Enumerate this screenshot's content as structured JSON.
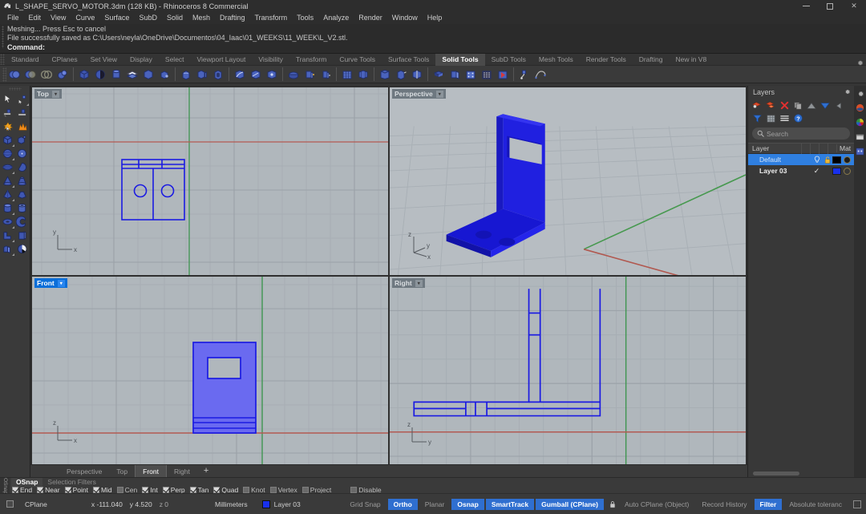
{
  "window": {
    "title": "L_SHAPE_SERVO_MOTOR.3dm (128 KB) - Rhinoceros 8 Commercial",
    "minimize_label": "Minimize",
    "maximize_label": "Maximize",
    "close_label": "Close"
  },
  "menu": {
    "items": [
      "File",
      "Edit",
      "View",
      "Curve",
      "Surface",
      "SubD",
      "Solid",
      "Mesh",
      "Drafting",
      "Transform",
      "Tools",
      "Analyze",
      "Render",
      "Window",
      "Help"
    ]
  },
  "command_area": {
    "history_line_1": "Meshing... Press Esc to cancel",
    "history_line_2": "File successfully saved as C:\\Users\\neyla\\OneDrive\\Documentos\\04_Iaac\\01_WEEKS\\11_WEEK\\L_V2.stl.",
    "prompt_label": "Command:",
    "prompt_value": ""
  },
  "toolbar_tabs": {
    "items": [
      "Standard",
      "CPlanes",
      "Set View",
      "Display",
      "Select",
      "Viewport Layout",
      "Visibility",
      "Transform",
      "Curve Tools",
      "Surface Tools",
      "Solid Tools",
      "SubD Tools",
      "Mesh Tools",
      "Render Tools",
      "Drafting",
      "New in V8"
    ],
    "active": "Solid Tools"
  },
  "icon_toolbar": {
    "groups": [
      [
        "boolean-union-icon",
        "boolean-difference-icon",
        "boolean-intersection-icon",
        "boolean-split-icon"
      ],
      [
        "box-icon",
        "sphere-icon",
        "cylinder-solid-icon",
        "extrude-surface-icon",
        "cube-edit-icon",
        "solid-point-icon"
      ],
      [
        "cap-planar-holes-icon",
        "extract-surface-icon",
        "shell-icon"
      ],
      [
        "fillet-edge-icon",
        "chamfer-edge-icon",
        "variable-fillet-icon"
      ],
      [
        "solid-union-icon",
        "offset-solid-icon",
        "wirecut-icon"
      ],
      [
        "mesh-from-surface-icon",
        "mesh-box-icon"
      ],
      [
        "move-face-icon",
        "rotate-face-icon",
        "split-face-icon"
      ],
      [
        "unroll-surface-icon",
        "extract-wireframe-icon",
        "mesh-repair-icon",
        "mesh-points-icon",
        "flag-icon"
      ],
      [
        "pipe-icon",
        "merge-icon"
      ]
    ]
  },
  "left_toolbar": {
    "rows": [
      [
        "selection-arrow-icon",
        "select-points-icon"
      ],
      [
        "move-object-icon",
        "copy-object-icon"
      ],
      [
        "explode-icon",
        "join-icon"
      ],
      [
        "box-solid-icon",
        "box-corner-icon"
      ],
      [
        "sphere-solid-icon",
        "sphere-center-icon"
      ],
      [
        "ellipsoid-icon",
        "paraboloid-icon"
      ],
      [
        "cone-icon",
        "truncated-cone-icon"
      ],
      [
        "pyramid-icon",
        "truncated-pyramid-icon"
      ],
      [
        "cylinder-icon",
        "tube-icon"
      ],
      [
        "torus-icon",
        "pipe-round-icon"
      ],
      [
        "pipe-curve-icon",
        "slab-icon"
      ],
      [
        "extrude-curve-icon",
        "sphere-cut-icon"
      ]
    ]
  },
  "viewports": [
    {
      "name": "Top",
      "active": false,
      "axis_x": "x",
      "axis_y": "y"
    },
    {
      "name": "Perspective",
      "active": false,
      "axis_x": "y",
      "axis_y": "z"
    },
    {
      "name": "Front",
      "active": true,
      "axis_x": "x",
      "axis_y": "z"
    },
    {
      "name": "Right",
      "active": false,
      "axis_x": "y",
      "axis_y": "z"
    }
  ],
  "viewport_tabs": {
    "items": [
      "Perspective",
      "Top",
      "Front",
      "Right"
    ],
    "active": "Front",
    "add_label": "+"
  },
  "layers_panel": {
    "title": "Layers",
    "settings_icon": "gear-icon",
    "toolbar_icons": [
      "new-layer-icon",
      "new-sublayer-icon",
      "delete-layer-icon",
      "duplicate-layer-icon",
      "move-up-icon",
      "move-down-icon",
      "collapse-icon",
      "filter-icon",
      "grid-view-icon",
      "list-view-icon",
      "help-icon"
    ],
    "search_placeholder": "Search",
    "search_value": "",
    "columns": [
      "Layer",
      "Mat"
    ],
    "rows": [
      {
        "name": "Default",
        "selected": true,
        "visible_icon": "lightbulb-icon",
        "lock_icon": "unlocked-icon",
        "color": "#000000",
        "material": "#1c1c1c",
        "current_check": ""
      },
      {
        "name": "Layer 03",
        "selected": false,
        "visible_icon": "",
        "lock_icon": "",
        "color": "#1830ec",
        "material": "none",
        "current_check": "✓"
      }
    ]
  },
  "right_side_icons": [
    "gear-icon",
    "render-icon",
    "color-wheel-icon",
    "display-mode-icon",
    "properties-icon"
  ],
  "osnap_bar": {
    "vertical_label": "OSnap",
    "tabs": [
      "OSnap",
      "Selection Filters"
    ],
    "active_tab": "OSnap",
    "checks": [
      {
        "label": "End",
        "checked": true
      },
      {
        "label": "Near",
        "checked": true
      },
      {
        "label": "Point",
        "checked": true
      },
      {
        "label": "Mid",
        "checked": true
      },
      {
        "label": "Cen",
        "checked": false
      },
      {
        "label": "Int",
        "checked": true
      },
      {
        "label": "Perp",
        "checked": true
      },
      {
        "label": "Tan",
        "checked": true
      },
      {
        "label": "Quad",
        "checked": true
      },
      {
        "label": "Knot",
        "checked": false
      },
      {
        "label": "Vertex",
        "checked": false
      },
      {
        "label": "Project",
        "checked": false
      },
      {
        "label": "Disable",
        "checked": false
      }
    ]
  },
  "status_bar": {
    "cplane_label": "CPlane",
    "coord_x": "x -111.040",
    "coord_y": "y 4.520",
    "coord_z": "z 0",
    "units": "Millimeters",
    "layer_name": "Layer 03",
    "layer_color": "#1830ec",
    "toggles": [
      {
        "label": "Grid Snap",
        "on": false
      },
      {
        "label": "Ortho",
        "on": true
      },
      {
        "label": "Planar",
        "on": false
      },
      {
        "label": "Osnap",
        "on": true
      },
      {
        "label": "SmartTrack",
        "on": true
      },
      {
        "label": "Gumball (CPlane)",
        "on": true
      }
    ],
    "auto_cplane_label": "Auto CPlane (Object)",
    "lock_icon": "padlock-icon",
    "record_history_label": "Record History",
    "filter_label": "Filter",
    "filter_on": true,
    "tolerance_label": "Absolute toleranc"
  },
  "colors": {
    "model_blue": "#1a1ae0",
    "viewport_bg": "#aeb5ba",
    "accent_blue": "#2f6fd0",
    "x_axis_red": "#c0504d",
    "y_axis_green": "#2f9e44"
  }
}
